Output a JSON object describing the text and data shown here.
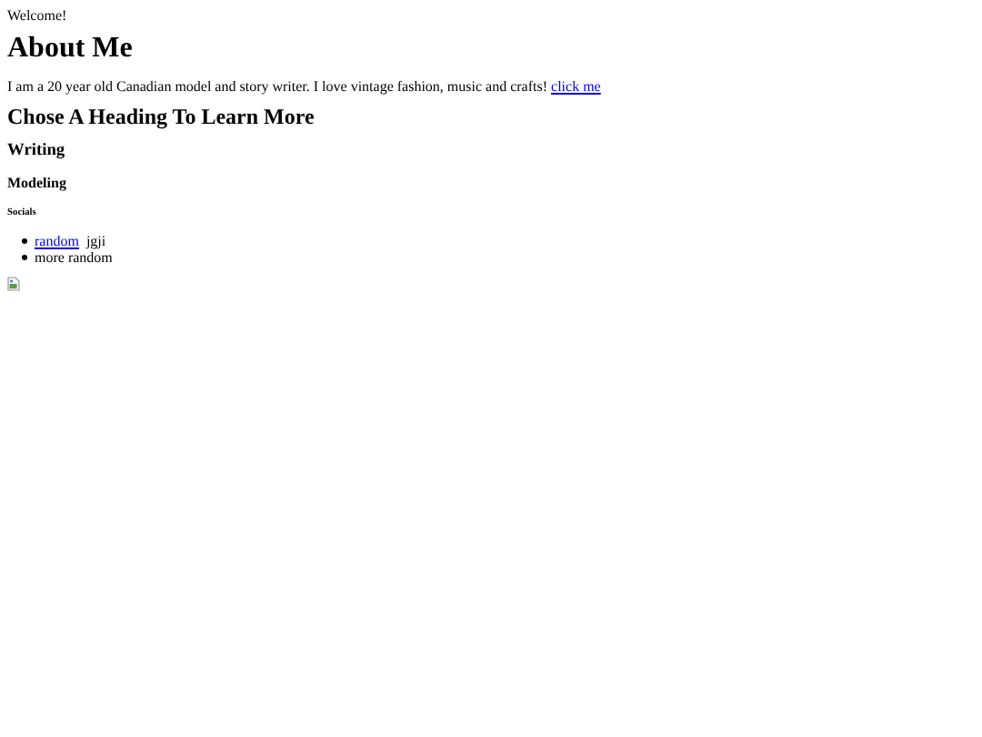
{
  "greeting": "Welcome!",
  "heading": "About Me",
  "intro": {
    "text": "I am a 20 year old Canadian model and story writer. I love vintage fashion, music and crafts!",
    "link": "click me"
  },
  "section_heading": "Chose A Heading To Learn More",
  "subheadings": [
    {
      "text": "Writing",
      "kind": "h3"
    },
    {
      "text": "Modeling",
      "kind": "h4"
    },
    {
      "text": "Socials",
      "kind": "h6"
    }
  ],
  "list": [
    {
      "link": "random",
      "text": "jgji"
    },
    {
      "text": "more random"
    }
  ],
  "image": {
    "kind": "broken"
  }
}
